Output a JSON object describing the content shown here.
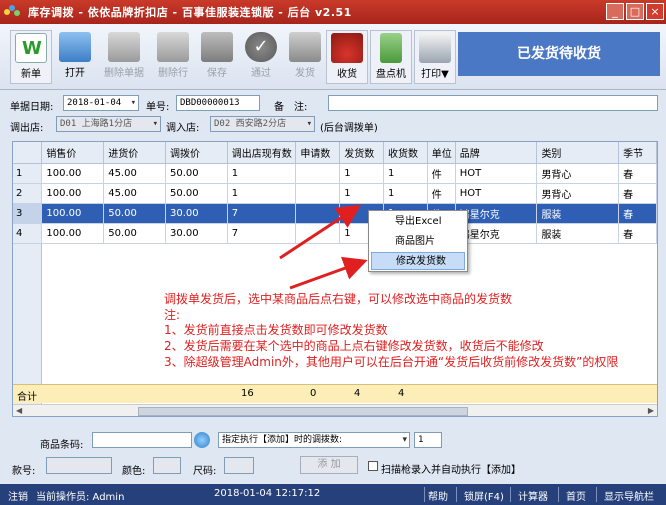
{
  "window": {
    "title": "库存调拨 - 依依品牌折扣店 - 百事佳服装连锁版 - 后台 v2.51",
    "minimize": "_",
    "maximize": "□",
    "close": "×"
  },
  "toolbar": {
    "buttons": [
      {
        "label": "新单",
        "icon": "new-doc-icon"
      },
      {
        "label": "打开",
        "icon": "open-folder-icon"
      },
      {
        "label": "删除单据",
        "icon": "delete-doc-icon"
      },
      {
        "label": "删除行",
        "icon": "delete-row-icon"
      },
      {
        "label": "保存",
        "icon": "save-icon"
      },
      {
        "label": "通过",
        "icon": "approve-icon"
      },
      {
        "label": "发货",
        "icon": "ship-icon"
      },
      {
        "label": "收货",
        "icon": "receive-basket-icon"
      },
      {
        "label": "盘点机",
        "icon": "scanner-icon"
      },
      {
        "label": "打印▼",
        "icon": "printer-icon"
      }
    ],
    "status": "已发货待收货"
  },
  "form": {
    "date_label": "单据日期:",
    "date_value": "2018-01-04",
    "doc_no_label": "单号:",
    "doc_no_value": "DBD00000013",
    "remark_label": "备　注:",
    "remark_value": "",
    "from_store_label": "调出店:",
    "from_store_value": "D01 上海路1分店",
    "to_store_label": "调入店:",
    "to_store_value": "D02 西安路2分店",
    "note": "(后台调拨单)"
  },
  "grid": {
    "columns": [
      "",
      "销售价",
      "进货价",
      "调拨价",
      "调出店现有数",
      "申请数",
      "发货数",
      "收货数",
      "单位",
      "品牌",
      "类别",
      "季节"
    ],
    "rows": [
      [
        "1",
        "100.00",
        "45.00",
        "50.00",
        "1",
        "",
        "1",
        "1",
        "件",
        "HOT",
        "男背心",
        "春"
      ],
      [
        "2",
        "100.00",
        "45.00",
        "50.00",
        "1",
        "",
        "1",
        "1",
        "件",
        "HOT",
        "男背心",
        "春"
      ],
      [
        "3",
        "100.00",
        "50.00",
        "30.00",
        "7",
        "",
        "1",
        "1",
        "件",
        "鸿星尔克",
        "服装",
        "春"
      ],
      [
        "4",
        "100.00",
        "50.00",
        "30.00",
        "7",
        "",
        "1",
        "1",
        "件",
        "鸿星尔克",
        "服装",
        "春"
      ]
    ],
    "selected_row": 3,
    "total_label": "合计",
    "totals": {
      "stock": "16",
      "apply": "0",
      "ship": "4",
      "recv": "4"
    }
  },
  "context_menu": [
    "导出Excel",
    "商品图片",
    "修改发货数"
  ],
  "annotation": {
    "lines": [
      "调拨单发货后，选中某商品后点右键，可以修改选中商品的发货数",
      "注:",
      "1、发货前直接点击发货数即可修改发货数",
      "2、发货后需要在某个选中的商品上点右键修改发货数，收货后不能修改",
      "3、除超级管理Admin外，其他用户可以在后台开通“发货后收货前修改发货数”的权限"
    ],
    "color": "#e02020"
  },
  "bottom": {
    "barcode_label": "商品条码:",
    "barcode_value": "",
    "mode_value": "指定执行【添加】时的调拨数:",
    "qty_value": "1",
    "style_label": "款号:",
    "color_label": "颜色:",
    "size_label": "尺码:",
    "add_button": "添 加",
    "auto_add_label": "扫描枪录入并自动执行【添加】"
  },
  "statusbar": {
    "logout": "注销",
    "operator": "当前操作员: Admin",
    "datetime": "2018-01-04  12:17:12",
    "help": "帮助",
    "lock": "锁屏(F4)",
    "calculator": "计算器",
    "home": "首页",
    "nav": "显示导航栏"
  }
}
